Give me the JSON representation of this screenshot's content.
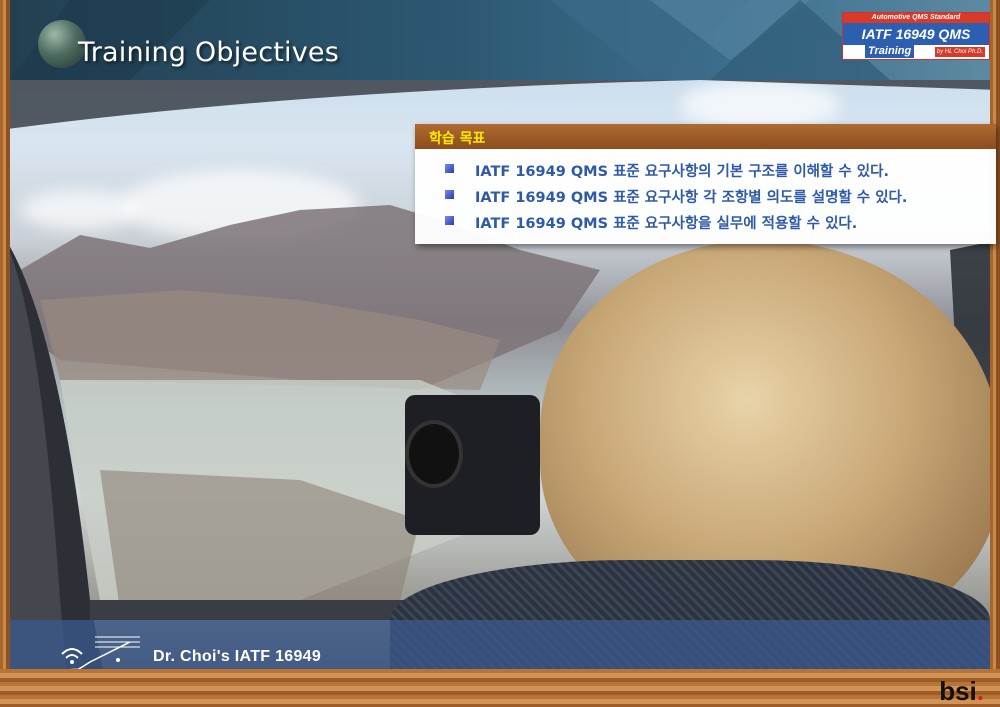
{
  "header": {
    "title": "Training Objectives"
  },
  "logo": {
    "top_line": "Automotive QMS Standard",
    "main_line": "IATF 16949 QMS",
    "training": "Training",
    "author": "by HL Choi Ph.D."
  },
  "objectives": {
    "heading": "학습 목표",
    "items": [
      "IATF 16949 QMS 표준 요구사항의 기본 구조를 이해할 수 있다.",
      "IATF 16949 QMS 표준 요구사항 각 조항별 의도를 설명할 수 있다.",
      "IATF 16949 QMS 표준 요구사항을 실무에 적용할 수 있다."
    ]
  },
  "footer": {
    "text": "Dr. Choi's IATF 16949",
    "brand": "bsi",
    "brand_dot": "."
  },
  "colors": {
    "title_bar": "#2a5873",
    "objective_text": "#2f5aa8",
    "objective_heading": "#ffe800",
    "header_wood": "#8a4d1c"
  }
}
